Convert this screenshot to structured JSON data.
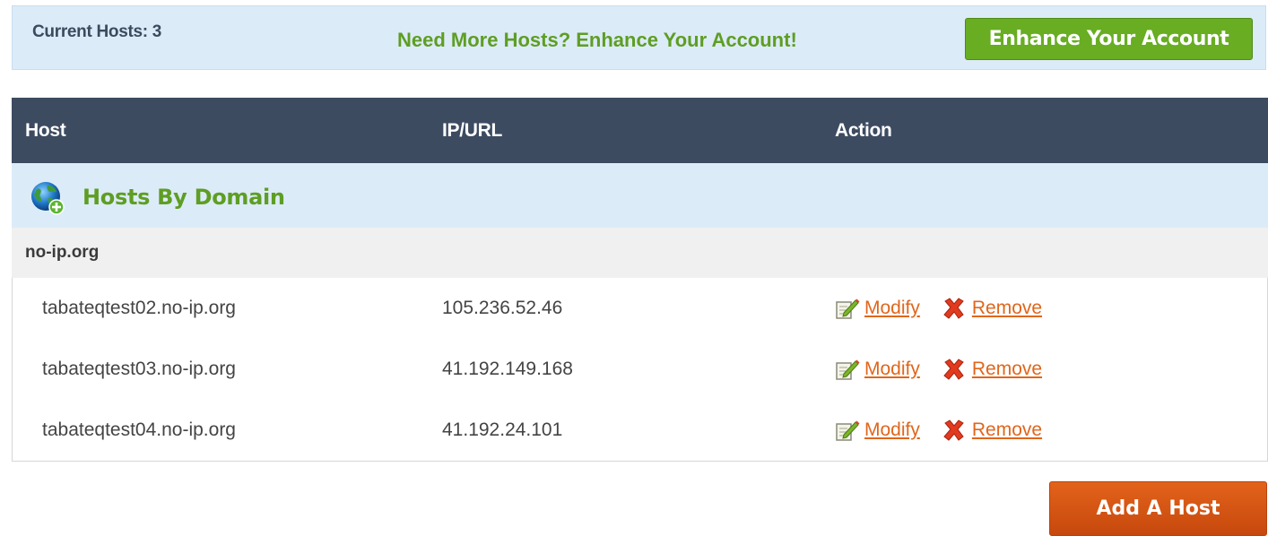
{
  "info_bar": {
    "current_hosts_label": "Current Hosts: 3",
    "upsell_text": "Need More Hosts? Enhance Your Account!",
    "enhance_button_label": "Enhance Your Account"
  },
  "table": {
    "headers": [
      "Host",
      "IP/URL",
      "Action"
    ],
    "group_title": "Hosts By Domain",
    "group_icon": "globe-add-icon",
    "domain": "no-ip.org",
    "rows": [
      {
        "host": "tabateqtest02.no-ip.org",
        "ip": "105.236.52.46",
        "modify": "Modify",
        "remove": "Remove"
      },
      {
        "host": "tabateqtest03.no-ip.org",
        "ip": "41.192.149.168",
        "modify": "Modify",
        "remove": "Remove"
      },
      {
        "host": "tabateqtest04.no-ip.org",
        "ip": "41.192.24.101",
        "modify": "Modify",
        "remove": "Remove"
      }
    ]
  },
  "add_host_button_label": "Add A Host",
  "colors": {
    "header_bg": "#3d4b61",
    "info_bg": "#dcebf8",
    "green_accent": "#5e9e23",
    "orange_accent": "#e0661c"
  }
}
